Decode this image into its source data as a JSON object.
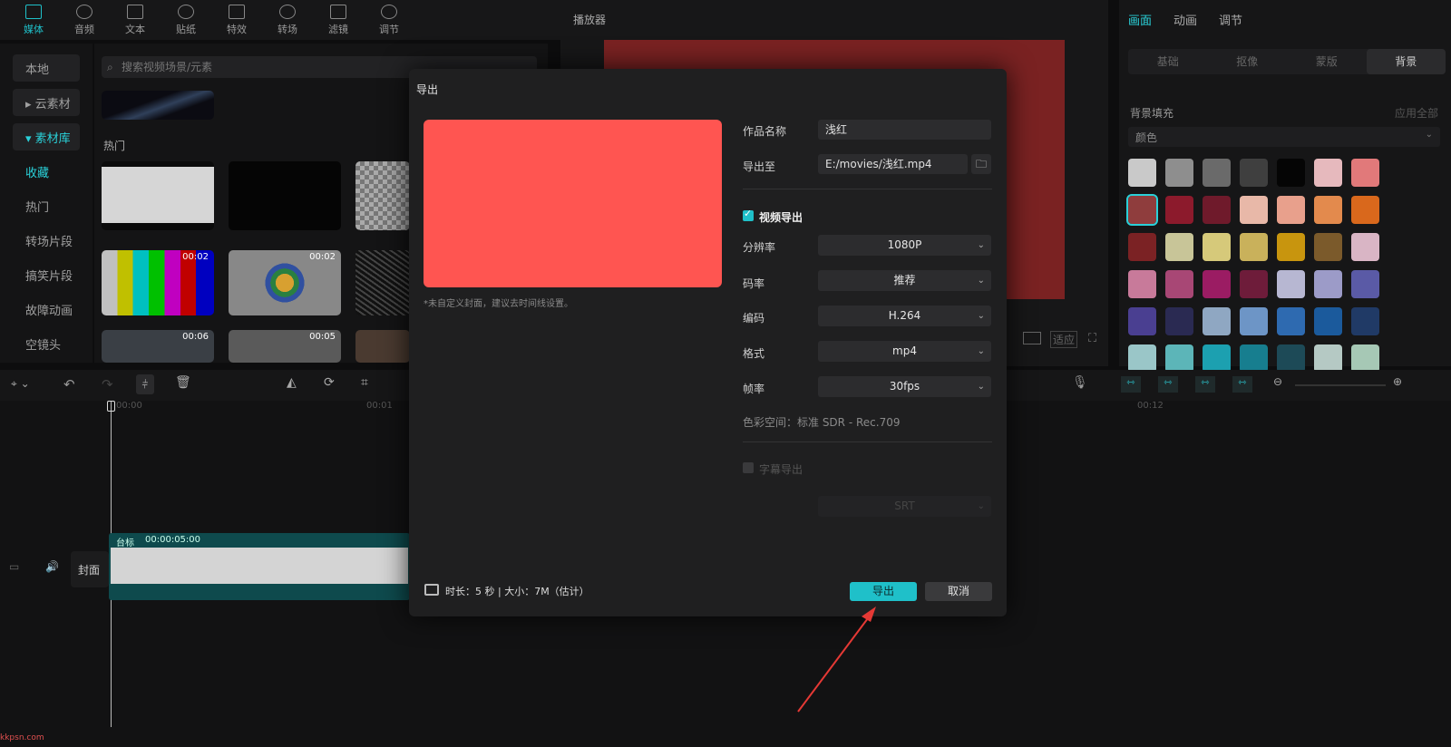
{
  "toolbar": {
    "items": [
      {
        "label": "媒体",
        "icon": "media-icon"
      },
      {
        "label": "音频",
        "icon": "audio-icon"
      },
      {
        "label": "文本",
        "icon": "text-icon"
      },
      {
        "label": "贴纸",
        "icon": "sticker-icon"
      },
      {
        "label": "特效",
        "icon": "effects-icon"
      },
      {
        "label": "转场",
        "icon": "transition-icon"
      },
      {
        "label": "滤镜",
        "icon": "filter-icon"
      },
      {
        "label": "调节",
        "icon": "adjust-icon"
      }
    ]
  },
  "leftnav": {
    "items": [
      "本地",
      "▸ 云素材",
      "▾ 素材库",
      "收藏",
      "热门",
      "转场片段",
      "搞笑片段",
      "故障动画",
      "空镜头"
    ]
  },
  "media": {
    "search_placeholder": "搜索视频场景/元素",
    "section": "热门",
    "durations": [
      "00:02",
      "00:02",
      "00:06",
      "00:05"
    ]
  },
  "player": {
    "title": "播放器",
    "fit_label": "适应"
  },
  "right_panel": {
    "tabs": [
      "画面",
      "动画",
      "调节"
    ],
    "segments": [
      "基础",
      "抠像",
      "蒙版",
      "背景"
    ],
    "fill_label": "背景填充",
    "apply_all": "应用全部",
    "fill_type": "颜色",
    "swatch_colors": [
      "#c9c9c9",
      "#8e8e8e",
      "#6a6a6a",
      "#3f3f3f",
      "#050505",
      "#e6b9bd",
      "#e1797a",
      "#8f3d3d",
      "#8c1a2c",
      "#6f1a2b",
      "#e8b8a8",
      "#e8a08c",
      "#e38a4d",
      "#d9681c",
      "#7b2224",
      "#c8c598",
      "#d6c97a",
      "#c9b15b",
      "#c8950e",
      "#7b5a2b",
      "#d9b5c5",
      "#c87a9a",
      "#a84775",
      "#9b1c63",
      "#6e1c3a",
      "#b7b7d2",
      "#9c9bc8",
      "#5a5aa6",
      "#4a3f91",
      "#2a2a52",
      "#8fa7c2",
      "#6d95c6",
      "#2e6ab0",
      "#1b5a9c",
      "#203a66",
      "#9ac6c8",
      "#5cb5b8",
      "#1ca0b0",
      "#177e8f",
      "#1d4a57",
      "#b5c9c4",
      "#a6c8b5"
    ]
  },
  "timeline": {
    "track_label": "封面",
    "clip_label": "台标",
    "clip_time": "00:00:05:00",
    "ruler": [
      "00:00",
      "00:01",
      "00:12"
    ]
  },
  "export_dialog": {
    "title": "导出",
    "hint": "*未自定义封面，建议去时间线设置。",
    "name_label": "作品名称",
    "name_value": "浅红",
    "export_to_label": "导出至",
    "export_to_value": "E:/movies/浅红.mp4",
    "video_export_label": "视频导出",
    "resolution_label": "分辨率",
    "resolution_value": "1080P",
    "bitrate_label": "码率",
    "bitrate_value": "推荐",
    "codec_label": "编码",
    "codec_value": "H.264",
    "format_label": "格式",
    "format_value": "mp4",
    "framerate_label": "帧率",
    "framerate_value": "30fps",
    "colorspace": "色彩空间：标准 SDR - Rec.709",
    "subtitle_export_label": "字幕导出",
    "subtitle_format_value": "SRT",
    "footer_info": "时长：5 秒 | 大小：7M（估计）",
    "export_button": "导出",
    "cancel_button": "取消",
    "accent": "#1fc0c9",
    "cover_color": "#ff5551"
  },
  "watermark": "kkpsn.com"
}
